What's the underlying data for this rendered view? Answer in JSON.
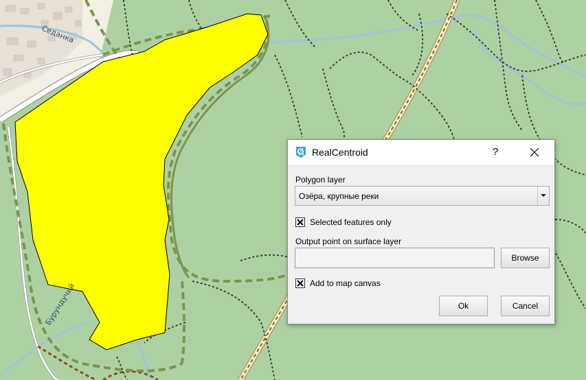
{
  "map": {
    "road_labels": [
      "Седанка",
      "Бурундучий"
    ],
    "colors": {
      "background": "#add1a2",
      "lake": "#ffff00",
      "settlement": "#f2efe4",
      "track": "#7d944f",
      "path": "#333333",
      "stream": "#9fc4da",
      "road": "#f2f2c0"
    }
  },
  "dialog": {
    "title": "RealCentroid",
    "app_icon": "qgis-plugin-icon",
    "help_label": "?",
    "close_icon": "close-icon",
    "polygon_layer": {
      "label": "Polygon layer",
      "selected": "Озёра, крупные реки"
    },
    "selected_only": {
      "label": "Selected features only",
      "checked": true
    },
    "output": {
      "label": "Output point on surface layer",
      "value": "",
      "browse_label": "Browse"
    },
    "add_to_map": {
      "label": "Add to map canvas",
      "checked": true
    },
    "ok_label": "Ok",
    "cancel_label": "Cancel"
  }
}
